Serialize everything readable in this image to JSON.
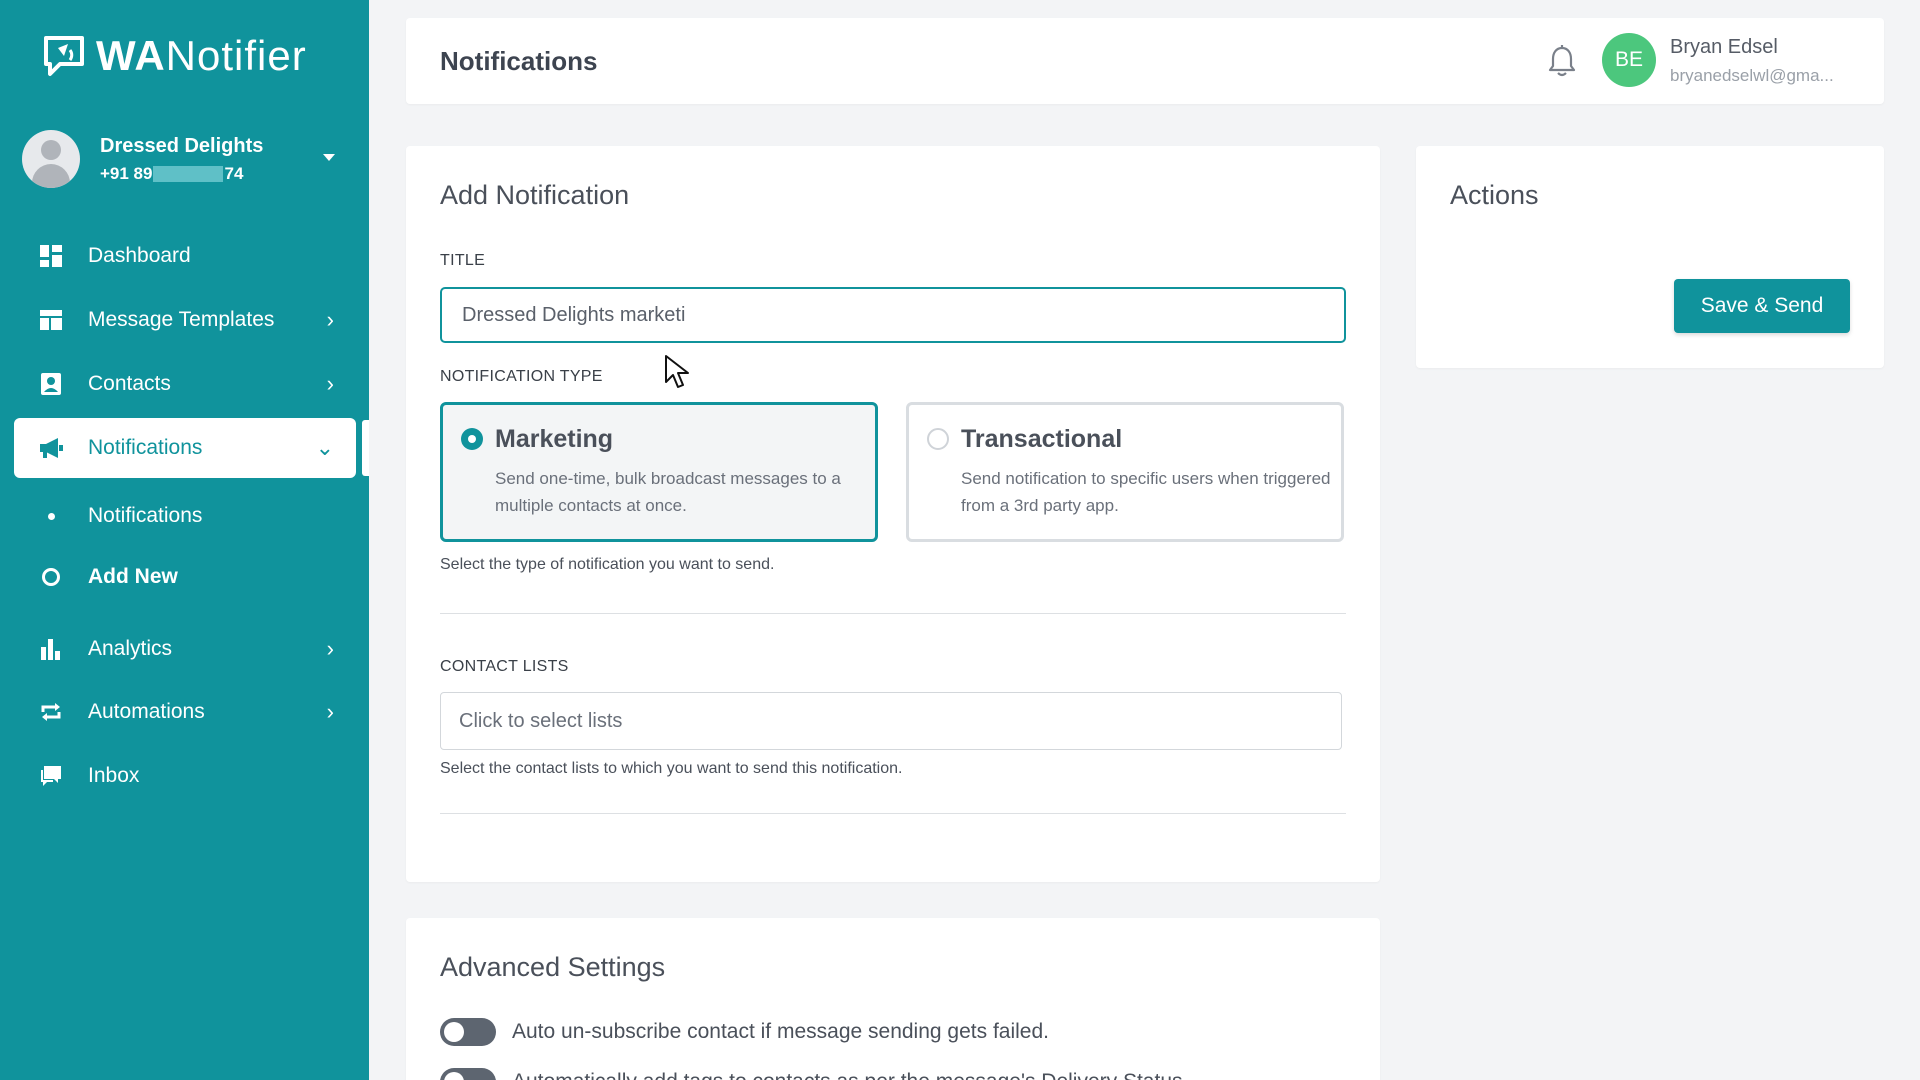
{
  "brand": {
    "logo_bold": "WA",
    "logo_rest": "Notifier"
  },
  "account": {
    "name": "Dressed Delights",
    "phone_prefix": "+91 89",
    "phone_suffix": "74"
  },
  "nav": {
    "dashboard": "Dashboard",
    "message_templates": "Message Templates",
    "contacts": "Contacts",
    "notifications": "Notifications",
    "sub_notifications": "Notifications",
    "sub_add_new": "Add New",
    "analytics": "Analytics",
    "automations": "Automations",
    "inbox": "Inbox"
  },
  "header": {
    "title": "Notifications",
    "user_initials": "BE",
    "user_name": "Bryan Edsel",
    "user_email": "bryanedselwl@gma..."
  },
  "form": {
    "card_title": "Add Notification",
    "title_label": "TITLE",
    "title_value": "Dressed Delights marketi",
    "type_label": "NOTIFICATION TYPE",
    "types": [
      {
        "name": "Marketing",
        "desc": "Send one-time, bulk broadcast messages to a multiple contacts at once.",
        "selected": true
      },
      {
        "name": "Transactional",
        "desc": "Send notification to specific users when triggered from a 3rd party app.",
        "selected": false
      }
    ],
    "type_help": "Select the type of notification you want to send.",
    "lists_label": "CONTACT LISTS",
    "lists_placeholder": "Click to select lists",
    "lists_help": "Select the contact lists to which you want to send this notification."
  },
  "actions": {
    "title": "Actions",
    "save_send": "Save & Send"
  },
  "advanced": {
    "title": "Advanced Settings",
    "toggle1": "Auto un-subscribe contact if message sending gets failed.",
    "toggle2": "Automatically add tags to contacts as per the message's Delivery Status"
  },
  "colors": {
    "accent": "#10939c",
    "avatar": "#4cc77d"
  }
}
